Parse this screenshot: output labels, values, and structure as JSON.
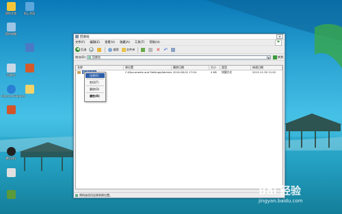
{
  "desktop": {
    "icons": [
      {
        "label": "我的文档",
        "color": "#f3c63a"
      },
      {
        "label": "网上邻居",
        "color": "#5ba6dc"
      },
      {
        "label": "我的电脑",
        "color": "#9cc4e4"
      },
      {
        "label": "回收站",
        "color": "#c8d8e6"
      },
      {
        "label": "Internet Explorer",
        "color": "#2a7fd4"
      },
      {
        "label": "",
        "color": "#d4542a"
      },
      {
        "label": "腾讯QQ",
        "color": "#222222"
      },
      {
        "label": "",
        "color": "#e0e0e0"
      },
      {
        "label": "",
        "color": "#5b9a3a"
      }
    ],
    "icons_right": [
      {
        "label": "",
        "color": "#2a9a3a"
      },
      {
        "label": "",
        "color": "#4a7ac4"
      },
      {
        "label": "",
        "color": "#f1b94a"
      }
    ]
  },
  "window": {
    "title": "回收站",
    "menu": [
      "文件(F)",
      "编辑(E)",
      "查看(V)",
      "收藏(A)",
      "工具(T)",
      "帮助(H)"
    ],
    "toolbar": {
      "back_label": "后退",
      "search_label": "搜索",
      "folders_label": "文件夹"
    },
    "address": {
      "label": "地址(D)",
      "value": "回收站",
      "go_label": "转到"
    },
    "columns": [
      "名称",
      "原位置",
      "删除日期",
      "大小",
      "类型",
      "修改日期"
    ],
    "rows": [
      {
        "name": "新建文件夹",
        "location": "C:\\Documents and Settings\\Administrator\\桌面",
        "deleted": "2014-08-01 17:04",
        "size": "4 KB",
        "type": "快捷方式",
        "modified": "2013-11-30 11:02"
      }
    ],
    "status": "将所选项目还原到原位置。"
  },
  "context_menu": {
    "items": [
      "还原(E)",
      "剪切(T)",
      "删除(D)",
      "属性(R)"
    ]
  },
  "watermark": {
    "logo": "Bai 经验",
    "url": "jingyan.baidu.com"
  }
}
